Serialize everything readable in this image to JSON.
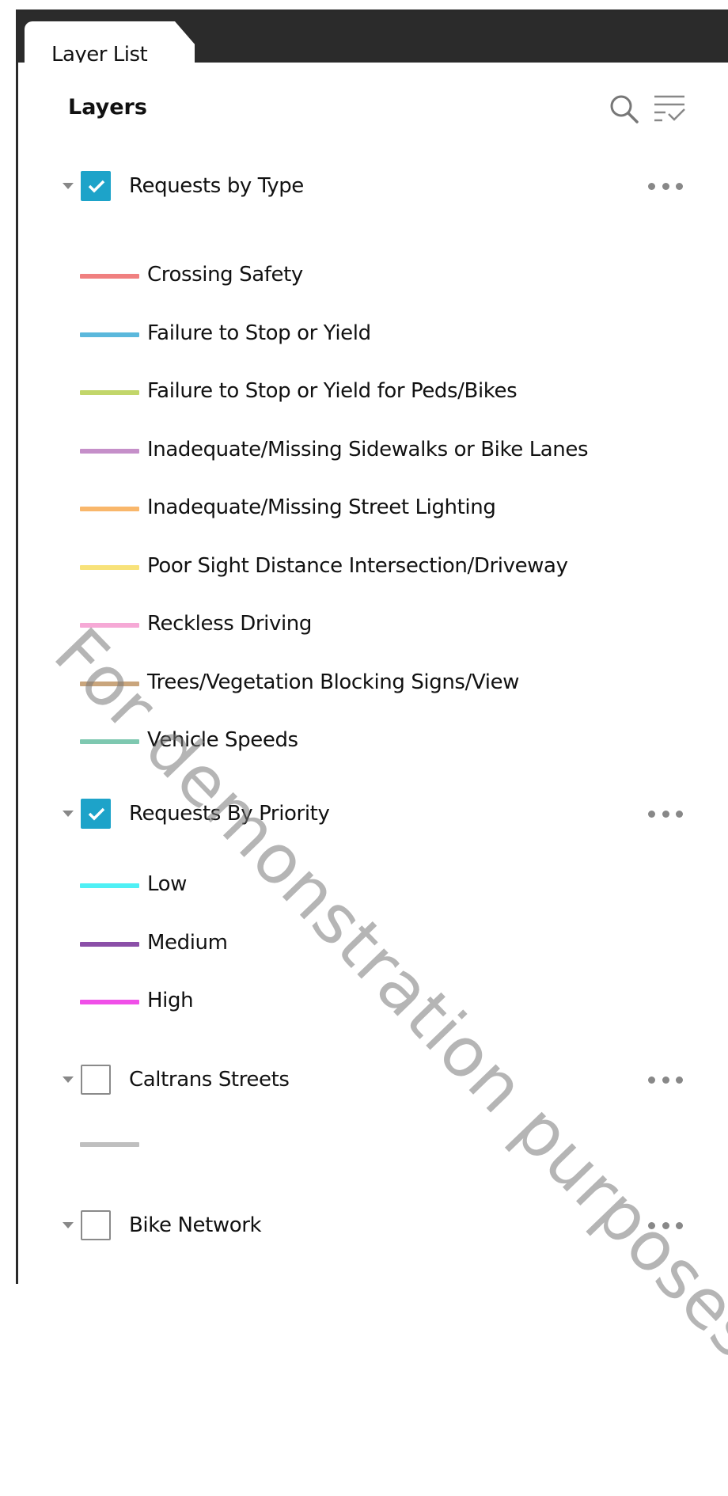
{
  "tab": {
    "label": "Layer List"
  },
  "header": {
    "title": "Layers",
    "search_icon": "search-icon",
    "filter_icon": "filter-list-icon"
  },
  "layers": [
    {
      "title": "Requests by Type",
      "checked": true,
      "legend": [
        {
          "label": "Crossing Safety",
          "color": "#f08080"
        },
        {
          "label": "Failure to Stop or Yield",
          "color": "#5bb8dc"
        },
        {
          "label": "Failure to Stop or Yield for Peds/Bikes",
          "color": "#c2d66a"
        },
        {
          "label": "Inadequate/Missing Sidewalks or Bike Lanes",
          "color": "#c58fc9"
        },
        {
          "label": "Inadequate/Missing Street Lighting",
          "color": "#f9b76b"
        },
        {
          "label": "Poor Sight Distance Intersection/Driveway",
          "color": "#f8e27a"
        },
        {
          "label": "Reckless Driving",
          "color": "#f6a9d6"
        },
        {
          "label": "Trees/Vegetation Blocking Signs/View",
          "color": "#c9a57c"
        },
        {
          "label": "Vehicle Speeds",
          "color": "#7ec8b0"
        }
      ]
    },
    {
      "title": "Requests By Priority",
      "checked": true,
      "legend": [
        {
          "label": "Low",
          "color": "#4ff0f5"
        },
        {
          "label": "Medium",
          "color": "#8b4fa8"
        },
        {
          "label": "High",
          "color": "#f04fe8"
        }
      ]
    },
    {
      "title": "Caltrans Streets",
      "checked": false,
      "legend": [
        {
          "label": "",
          "color": "#bfbfbf"
        }
      ]
    },
    {
      "title": "Bike Network",
      "checked": false,
      "legend": []
    }
  ],
  "watermark": "For demonstration purposes only"
}
